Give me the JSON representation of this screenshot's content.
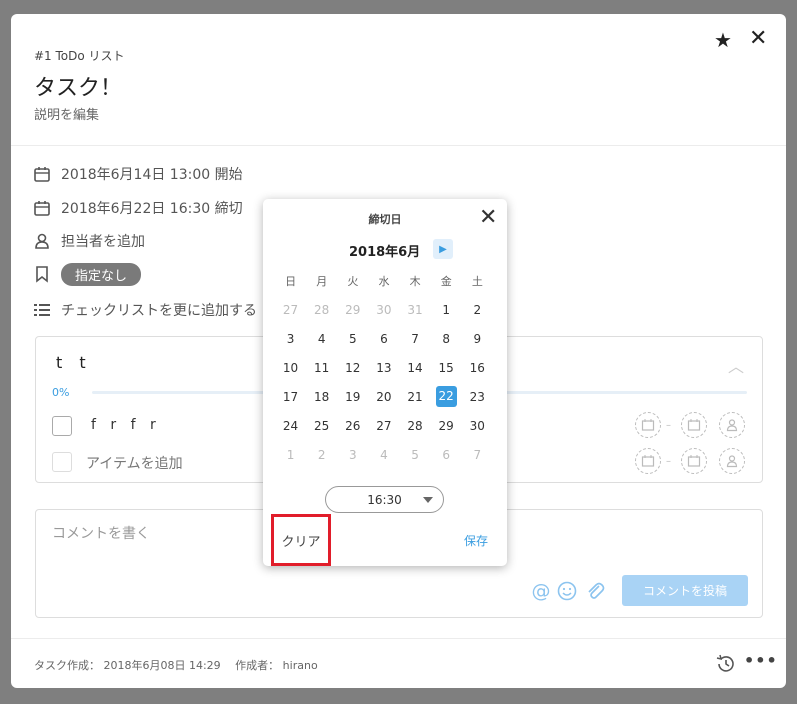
{
  "header": {
    "crumb": "#1 ToDo リスト",
    "title": "タスク！",
    "desc": "説明を編集"
  },
  "rows": {
    "start": "2018年6月14日 13:00 開始",
    "due": "2018年6月22日 16:30 締切",
    "assignee": "担当者を追加",
    "tag": "指定なし",
    "checklist_add": "チェックリストを更に追加する"
  },
  "checklist": {
    "title": "t t",
    "progress": "0%",
    "progress_value": 0,
    "item": "f r f r",
    "add_item": "アイテムを追加"
  },
  "comment": {
    "placeholder": "コメントを書く",
    "post": "コメントを投稿"
  },
  "footer": {
    "created": "タスク作成： 2018年6月08日 14:29　 作成者： hirano"
  },
  "datepicker": {
    "title": "締切日",
    "month": "2018年6月",
    "weekdays": [
      "日",
      "月",
      "火",
      "水",
      "木",
      "金",
      "土"
    ],
    "weeks": [
      [
        "27",
        "28",
        "29",
        "30",
        "31",
        "1",
        "2"
      ],
      [
        "3",
        "4",
        "5",
        "6",
        "7",
        "8",
        "9"
      ],
      [
        "10",
        "11",
        "12",
        "13",
        "14",
        "15",
        "16"
      ],
      [
        "17",
        "18",
        "19",
        "20",
        "21",
        "22",
        "23"
      ],
      [
        "24",
        "25",
        "26",
        "27",
        "28",
        "29",
        "30"
      ],
      [
        "1",
        "2",
        "3",
        "4",
        "5",
        "6",
        "7"
      ]
    ],
    "selected": "22",
    "time": "16:30",
    "clear": "クリア",
    "save": "保存"
  },
  "colors": {
    "accent": "#3a9de0",
    "highlight": "#e11d2a",
    "overlay": "#7f7f7f"
  }
}
